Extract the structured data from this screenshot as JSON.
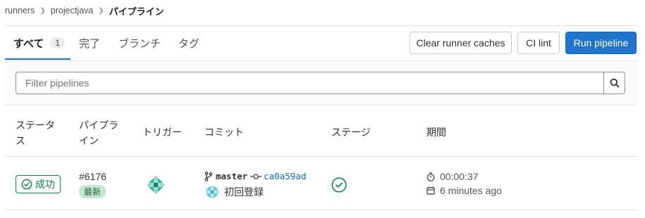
{
  "breadcrumb": {
    "items": [
      "runners",
      "projectjava"
    ],
    "current": "パイプライン"
  },
  "tabs": [
    {
      "label": "すべて",
      "count": "1"
    },
    {
      "label": "完了"
    },
    {
      "label": "ブランチ"
    },
    {
      "label": "タグ"
    }
  ],
  "actions": {
    "clear_cache": "Clear runner caches",
    "ci_lint": "CI lint",
    "run_pipeline": "Run pipeline"
  },
  "filter": {
    "placeholder": "Filter pipelines"
  },
  "table": {
    "headers": {
      "status": "ステータス",
      "pipeline": "パイプライン",
      "trigger": "トリガー",
      "commit": "コミット",
      "stage": "ステージ",
      "duration": "期間"
    },
    "rows": [
      {
        "status": "成功",
        "pipeline_id": "#6176",
        "latest": "最新",
        "branch": "master",
        "sha": "ca0a59ad",
        "commit_title": "初回登録",
        "duration": "00:00:37",
        "finished": "6 minutes ago"
      }
    ]
  },
  "colors": {
    "primary": "#1f75cb",
    "success": "#108548",
    "avatar": "#1aa28e"
  }
}
